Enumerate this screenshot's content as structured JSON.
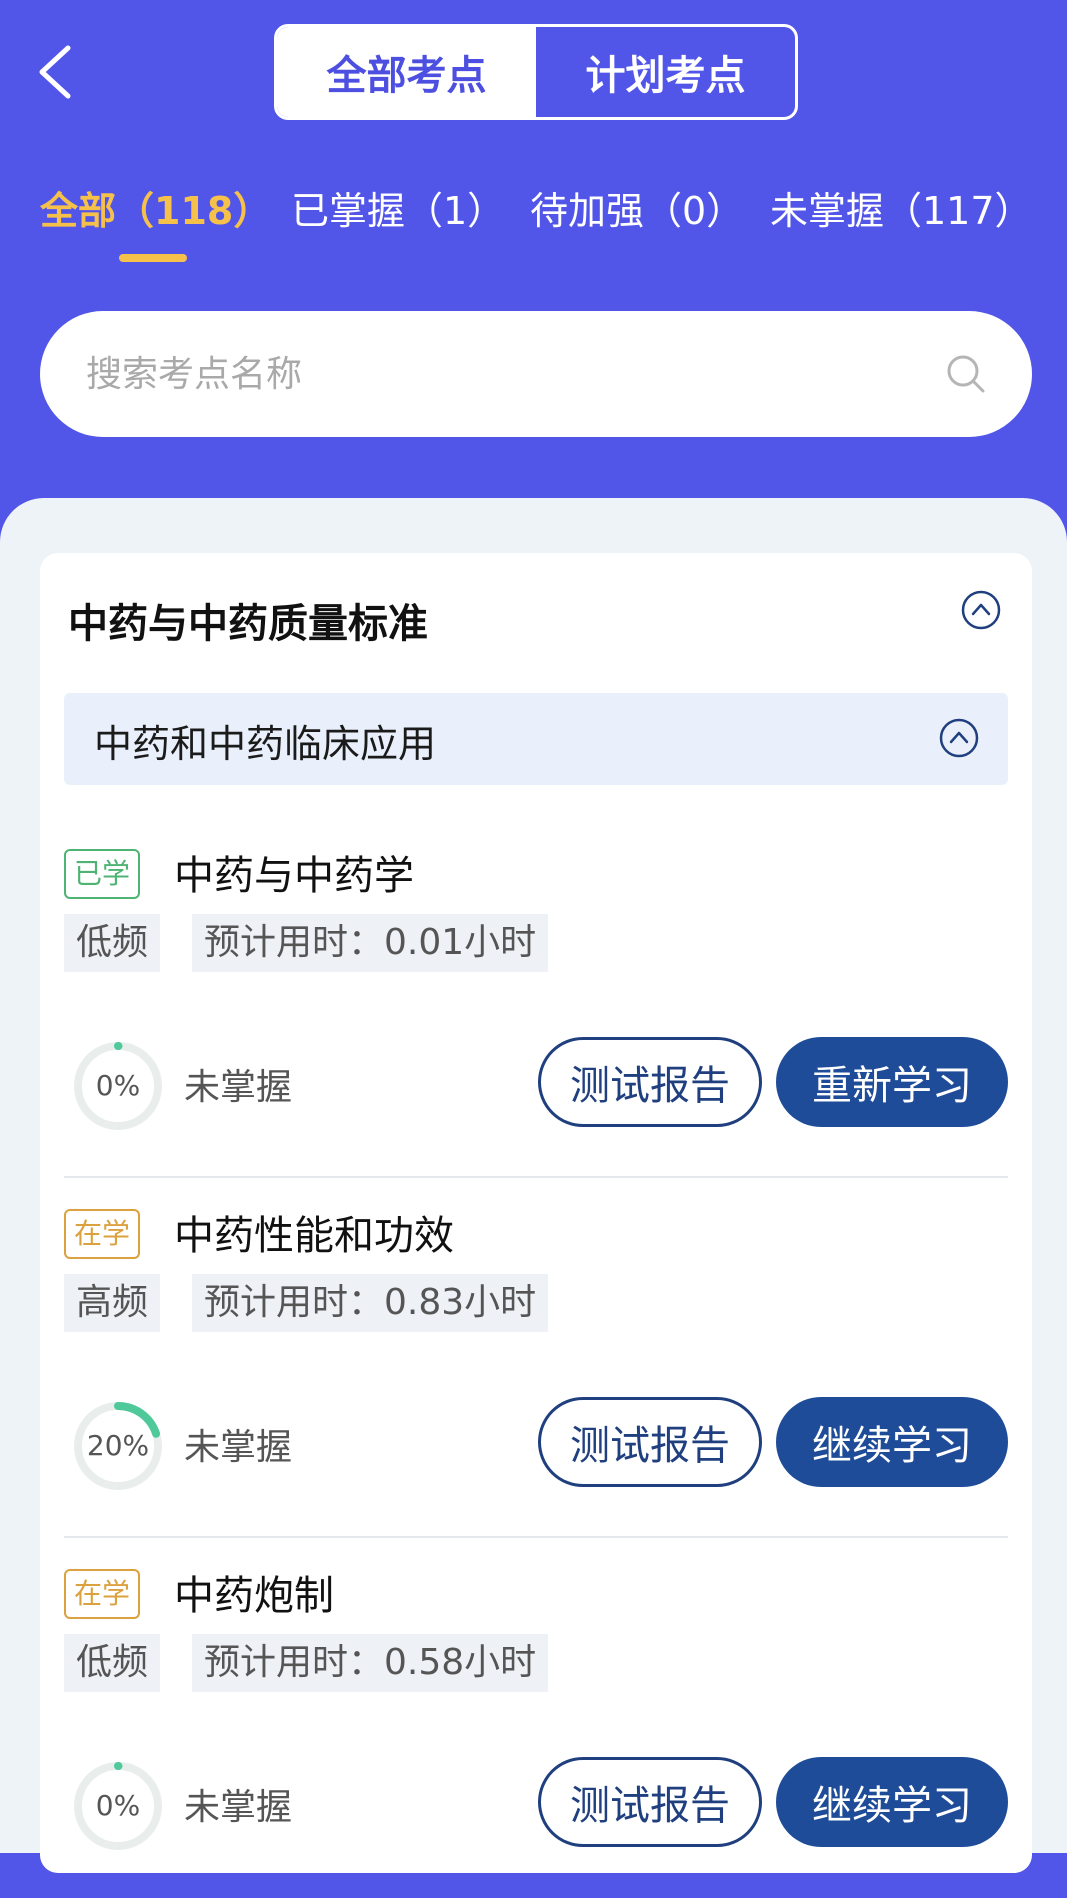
{
  "header": {
    "segments": [
      "全部考点",
      "计划考点"
    ],
    "filters": [
      {
        "label": "全部（118）"
      },
      {
        "label": "已掌握（1）"
      },
      {
        "label": "待加强（0）"
      },
      {
        "label": "未掌握（117）"
      }
    ],
    "search_placeholder": "搜索考点名称"
  },
  "colors": {
    "header_bg": "#5256e8",
    "accent_yellow": "#f6c14b",
    "primary_blue": "#1f4c98",
    "learned_green": "#4eb373",
    "learning_orange": "#dca13f"
  },
  "chapter": {
    "title": "中药与中药质量标准",
    "section_title": "中药和中药临床应用",
    "points": [
      {
        "status": "已学",
        "title": "中药与中药学",
        "freq": "低频",
        "time": "预计用时：0.01小时",
        "progress_label": "0%",
        "progress": 0,
        "mastery": "未掌握",
        "report_label": "测试报告",
        "study_label": "重新学习"
      },
      {
        "status": "在学",
        "title": "中药性能和功效",
        "freq": "高频",
        "time": "预计用时：0.83小时",
        "progress_label": "20%",
        "progress": 20,
        "mastery": "未掌握",
        "report_label": "测试报告",
        "study_label": "继续学习"
      },
      {
        "status": "在学",
        "title": "中药炮制",
        "freq": "低频",
        "time": "预计用时：0.58小时",
        "progress_label": "0%",
        "progress": 0,
        "mastery": "未掌握",
        "report_label": "测试报告",
        "study_label": "继续学习"
      }
    ]
  }
}
